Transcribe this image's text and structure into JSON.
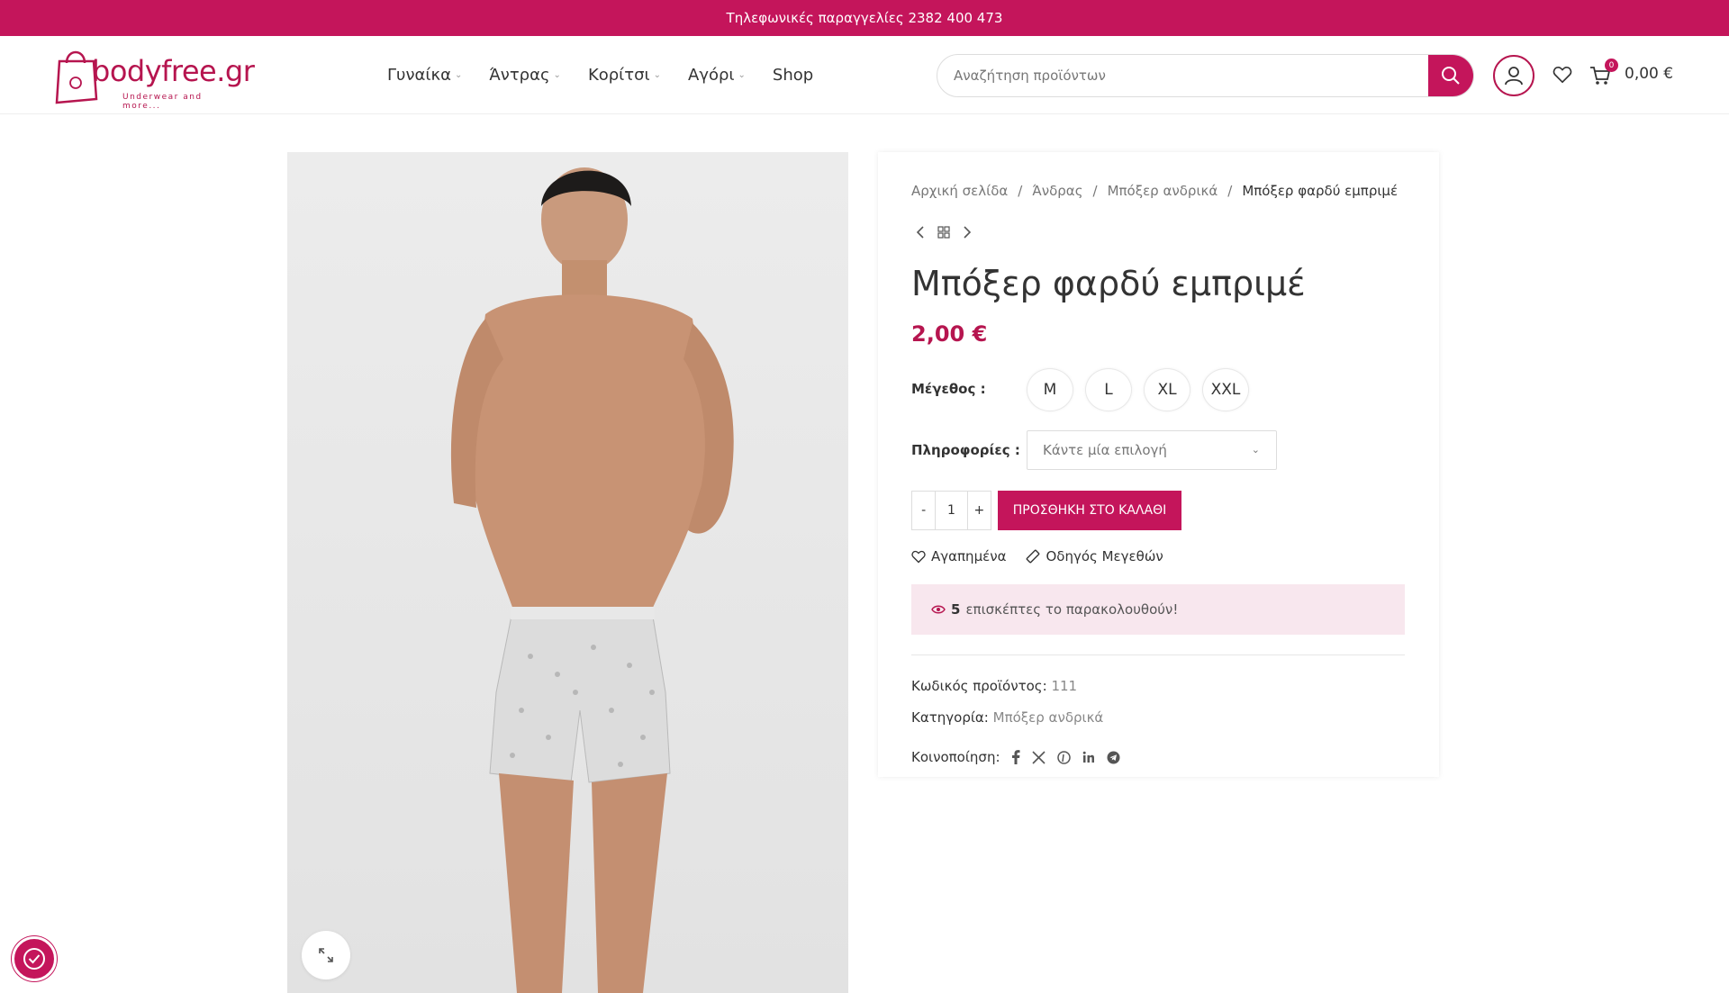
{
  "topbar": {
    "text": "Τηλεφωνικές παραγγελίες  2382 400 473"
  },
  "logo": {
    "brand": "bodyfree.gr",
    "tagline": "Underwear and more..."
  },
  "nav": {
    "items": [
      {
        "label": "Γυναίκα",
        "dropdown": true
      },
      {
        "label": "Άντρας",
        "dropdown": true
      },
      {
        "label": "Κορίτσι",
        "dropdown": true
      },
      {
        "label": "Αγόρι",
        "dropdown": true
      },
      {
        "label": "Shop",
        "dropdown": false
      }
    ]
  },
  "search": {
    "placeholder": "Αναζήτηση προϊόντων",
    "value": ""
  },
  "cart": {
    "count": "0",
    "total": "0,00 €"
  },
  "breadcrumb": {
    "home": "Αρχική σελίδα",
    "level1": "Άνδρας",
    "level2": "Μπόξερ ανδρικά",
    "current": "Μπόξερ φαρδύ εμπριμέ",
    "separator": "/"
  },
  "product": {
    "title": "Μπόξερ φαρδύ εμπριμέ",
    "price": "2,00 €",
    "size_label": "Μέγεθος :",
    "sizes": [
      "M",
      "L",
      "XL",
      "XXL"
    ],
    "info_label": "Πληροφορίες :",
    "info_placeholder": "Κάντε μία επιλογή",
    "qty_minus": "-",
    "qty_value": "1",
    "qty_plus": "+",
    "add_to_cart": "ΠΡΟΣΘΗΚΗ ΣΤΟ ΚΑΛΑΘΙ",
    "wishlist": "Αγαπημένα",
    "size_guide": "Οδηγός Μεγεθών",
    "watchers_count": "5",
    "watchers_text": "επισκέπτες το παρακολουθούν!",
    "sku_label": "Κωδικός προϊόντος:",
    "sku_value": "111",
    "category_label": "Κατηγορία:",
    "category_value": "Μπόξερ ανδρικά",
    "share_label": "Κοινοποίηση:"
  },
  "colors": {
    "accent": "#c4155b",
    "watch_bg": "#f8e7ee"
  }
}
